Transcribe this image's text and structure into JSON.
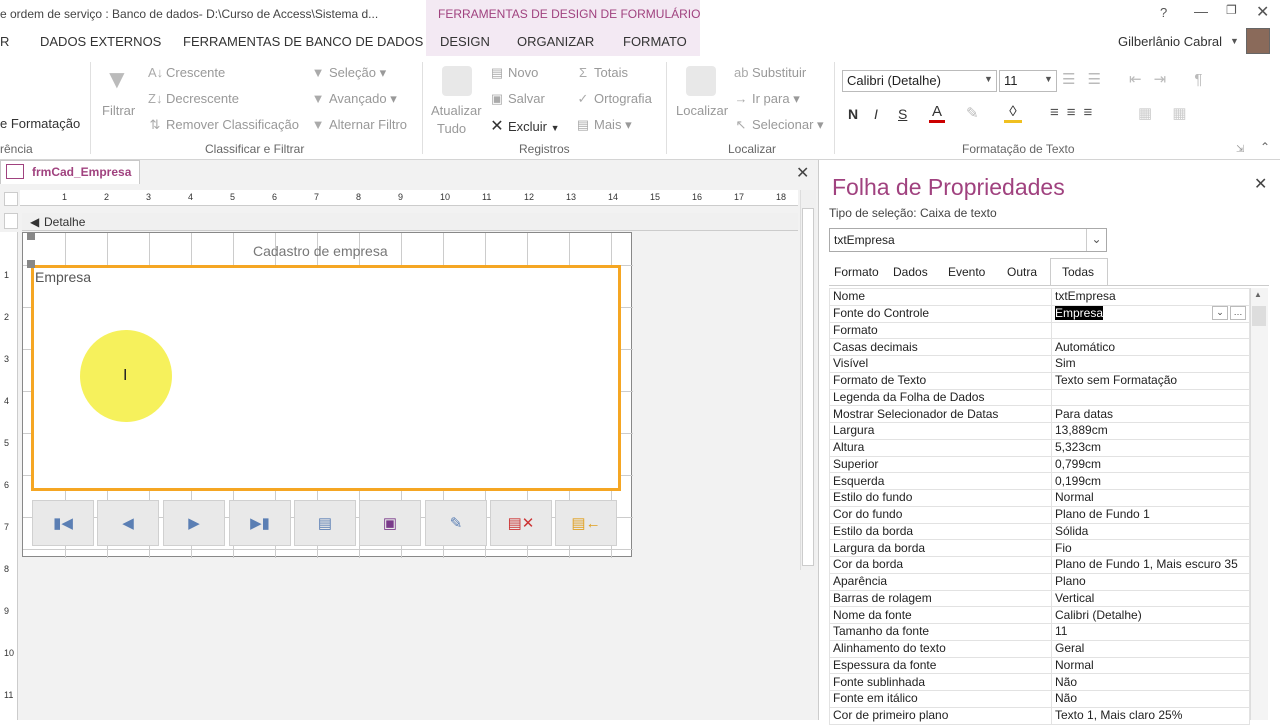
{
  "window": {
    "title": "e ordem de serviço : Banco de dados- D:\\Curso de Access\\Sistema d...",
    "context_label": "FERRAMENTAS DE DESIGN DE FORMULÁRIO",
    "help": "?",
    "user": "Gilberlânio Cabral"
  },
  "tabs": [
    "R",
    "DADOS EXTERNOS",
    "FERRAMENTAS DE BANCO DE DADOS",
    "DESIGN",
    "ORGANIZAR",
    "FORMATO"
  ],
  "ribbon": {
    "left_items": [
      "e Formatação",
      "rência"
    ],
    "sort_filter": {
      "filter": "Filtrar",
      "asc": "Crescente",
      "desc": "Decrescente",
      "remove": "Remover Classificação",
      "selection": "Seleção",
      "advanced": "Avançado",
      "toggle": "Alternar Filtro",
      "group": "Classificar e Filtrar"
    },
    "records": {
      "refresh": "Atualizar",
      "refresh2": "Tudo",
      "new": "Novo",
      "save": "Salvar",
      "delete": "Excluir",
      "totals": "Totais",
      "spelling": "Ortografia",
      "more": "Mais",
      "group": "Registros"
    },
    "find": {
      "find": "Localizar",
      "replace": "Substituir",
      "goto": "Ir para",
      "select": "Selecionar",
      "group": "Localizar"
    },
    "text_format": {
      "font": "Calibri (Detalhe)",
      "size": "11",
      "bold": "N",
      "italic": "I",
      "underline": "S",
      "group": "Formatação de Texto"
    }
  },
  "document": {
    "tab_label": "frmCad_Empresa",
    "section": "Detalhe",
    "form_title": "Cadastro de empresa",
    "textbox_label": "Empresa",
    "ruler_h": [
      "1",
      "2",
      "3",
      "4",
      "5",
      "6",
      "7",
      "8",
      "9",
      "10",
      "11",
      "12",
      "13",
      "14",
      "15",
      "16",
      "17",
      "18"
    ],
    "ruler_v": [
      "1",
      "2",
      "3",
      "4",
      "5",
      "6",
      "7",
      "8",
      "9",
      "10",
      "11"
    ]
  },
  "property_sheet": {
    "title": "Folha de Propriedades",
    "selection_type": "Tipo de seleção:  Caixa de texto",
    "selected_control": "txtEmpresa",
    "tabs": [
      "Formato",
      "Dados",
      "Evento",
      "Outra",
      "Todas"
    ],
    "active_tab": "Todas",
    "rows": [
      {
        "k": "Nome",
        "v": "txtEmpresa"
      },
      {
        "k": "Fonte do Controle",
        "v": "Empresa"
      },
      {
        "k": "Formato",
        "v": ""
      },
      {
        "k": "Casas decimais",
        "v": "Automático"
      },
      {
        "k": "Visível",
        "v": "Sim"
      },
      {
        "k": "Formato de Texto",
        "v": "Texto sem Formatação"
      },
      {
        "k": "Legenda da Folha de Dados",
        "v": ""
      },
      {
        "k": "Mostrar Selecionador de Datas",
        "v": "Para datas"
      },
      {
        "k": "Largura",
        "v": "13,889cm"
      },
      {
        "k": "Altura",
        "v": "5,323cm"
      },
      {
        "k": "Superior",
        "v": "0,799cm"
      },
      {
        "k": "Esquerda",
        "v": "0,199cm"
      },
      {
        "k": "Estilo do fundo",
        "v": "Normal"
      },
      {
        "k": "Cor do fundo",
        "v": "Plano de Fundo 1"
      },
      {
        "k": "Estilo da borda",
        "v": "Sólida"
      },
      {
        "k": "Largura da borda",
        "v": "Fio"
      },
      {
        "k": "Cor da borda",
        "v": "Plano de Fundo 1, Mais escuro 35"
      },
      {
        "k": "Aparência",
        "v": "Plano"
      },
      {
        "k": "Barras de rolagem",
        "v": "Vertical"
      },
      {
        "k": "Nome da fonte",
        "v": "Calibri (Detalhe)"
      },
      {
        "k": "Tamanho da fonte",
        "v": "11"
      },
      {
        "k": "Alinhamento do texto",
        "v": "Geral"
      },
      {
        "k": "Espessura da fonte",
        "v": "Normal"
      },
      {
        "k": "Fonte sublinhada",
        "v": "Não"
      },
      {
        "k": "Fonte em itálico",
        "v": "Não"
      },
      {
        "k": "Cor de primeiro plano",
        "v": "Texto 1, Mais claro 25%"
      }
    ]
  },
  "colors": {
    "accent": "#a0427f",
    "selection_border": "#f5a623",
    "highlight": "#f5f04a"
  }
}
